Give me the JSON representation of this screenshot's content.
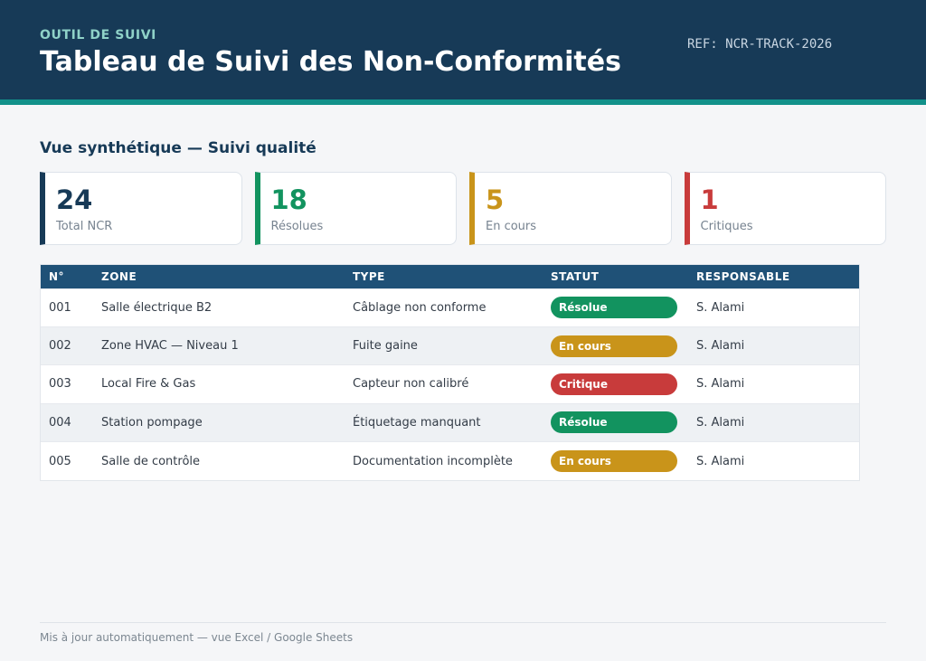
{
  "header": {
    "eyebrow": "OUTIL DE SUIVI",
    "title": "Tableau de Suivi des Non-Conformités",
    "ref": "REF: NCR-TRACK-2026"
  },
  "section_title": "Vue synthétique — Suivi qualité",
  "kpis": [
    {
      "value": "24",
      "label": "Total NCR",
      "color": "#173a57"
    },
    {
      "value": "18",
      "label": "Résolues",
      "color": "#12935f"
    },
    {
      "value": "5",
      "label": "En cours",
      "color": "#c9941a"
    },
    {
      "value": "1",
      "label": "Critiques",
      "color": "#c83b3b"
    }
  ],
  "table": {
    "columns": [
      "N°",
      "ZONE",
      "TYPE",
      "STATUT",
      "RESPONSABLE"
    ],
    "rows": [
      {
        "num": "001",
        "zone": "Salle électrique B2",
        "type": "Câblage non conforme",
        "status": "Résolue",
        "status_color": "#12935f",
        "owner": "S. Alami"
      },
      {
        "num": "002",
        "zone": "Zone HVAC — Niveau 1",
        "type": "Fuite gaine",
        "status": "En cours",
        "status_color": "#c9941a",
        "owner": "S. Alami"
      },
      {
        "num": "003",
        "zone": "Local Fire & Gas",
        "type": "Capteur non calibré",
        "status": "Critique",
        "status_color": "#c83b3b",
        "owner": "S. Alami"
      },
      {
        "num": "004",
        "zone": "Station pompage",
        "type": "Étiquetage manquant",
        "status": "Résolue",
        "status_color": "#12935f",
        "owner": "S. Alami"
      },
      {
        "num": "005",
        "zone": "Salle de contrôle",
        "type": "Documentation incomplète",
        "status": "En cours",
        "status_color": "#c9941a",
        "owner": "S. Alami"
      }
    ]
  },
  "footer": "Mis à jour automatiquement — vue Excel / Google Sheets"
}
